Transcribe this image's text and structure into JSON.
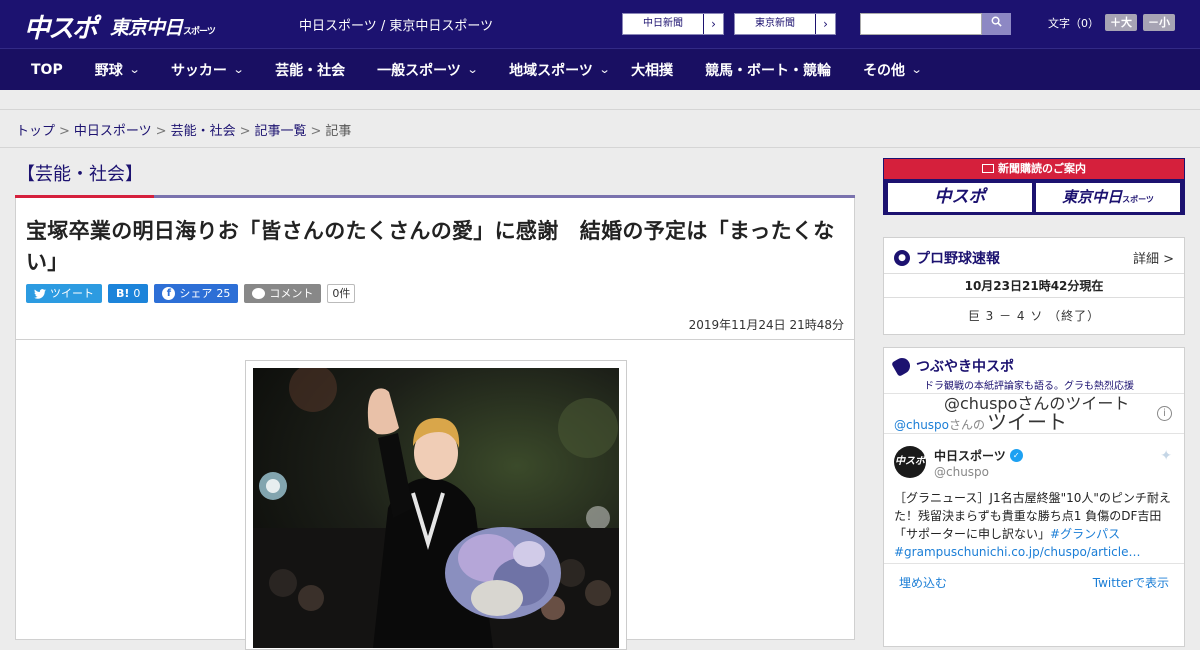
{
  "header": {
    "logo_main": "中スポ",
    "logo_sub": "東京中日",
    "logo_sub_small": "スポーツ",
    "site_name": "中日スポーツ / 東京中日スポーツ",
    "paper_links": [
      {
        "label": "中日新聞"
      },
      {
        "label": "東京新聞"
      }
    ],
    "search_placeholder": "",
    "fontsize_label": "文字（0）",
    "fontsize_up": "＋大",
    "fontsize_down": "－小"
  },
  "nav": {
    "items": [
      {
        "label": "TOP",
        "has_dropdown": false
      },
      {
        "label": "野球",
        "has_dropdown": true
      },
      {
        "label": "サッカー",
        "has_dropdown": true
      },
      {
        "label": "芸能・社会",
        "has_dropdown": false
      },
      {
        "label": "一般スポーツ",
        "has_dropdown": true
      },
      {
        "label": "地域スポーツ",
        "has_dropdown": true
      },
      {
        "label": "大相撲",
        "has_dropdown": false
      },
      {
        "label": "競馬・ボート・競輪",
        "has_dropdown": false
      },
      {
        "label": "その他",
        "has_dropdown": true
      }
    ]
  },
  "breadcrumb": {
    "items": [
      "トップ",
      "中日スポーツ",
      "芸能・社会",
      "記事一覧"
    ],
    "current": "記事",
    "separator": ">"
  },
  "article": {
    "category": "【芸能・社会】",
    "headline": "宝塚卒業の明日海りお「皆さんのたくさんの愛」に感謝　結婚の予定は「まったくない」",
    "share": {
      "tweet_label": "ツイート",
      "hatena_label": "B!",
      "hatena_count": "0",
      "facebook_label": "シェア",
      "facebook_count": "25",
      "comment_label": "コメント",
      "comment_count": "0件"
    },
    "timestamp": "2019年11月24日 21時48分"
  },
  "sidebar": {
    "promo": {
      "title": "新聞購読のご案内",
      "btn_a": "中スポ",
      "btn_b": "東京中日",
      "btn_b_small": "スポーツ"
    },
    "baseball": {
      "title": "プロ野球速報",
      "more": "詳細 >",
      "time": "10月23日21時42分現在",
      "score": "巨 3 － 4 ソ （終了）"
    },
    "tsubuyaki": {
      "title": "つぶやき中スポ",
      "subtitle": "ドラ観戦の本紙評論家も語る。グラも熱烈応援",
      "user_prefix": "@chuspo",
      "user_mid": "さんの",
      "user_big": "ツイート",
      "tweet_name": "中日スポーツ",
      "tweet_handle": "@chuspo",
      "avatar": "中スポ",
      "tweet_text": "［グラニュース］J1名古屋終盤\"10人\"のピンチ耐えた！残留決まらずも貴重な勝ち点1 負傷のDF吉田「サポーターに申し訳ない」",
      "tweet_hash": "#グランパス",
      "tweet_link": "#grampuschunichi.co.jp/chuspo/article…",
      "embed": "埋め込む",
      "view_on": "Twitterで表示",
      "next_title": "@chuspoさんのツイート"
    }
  }
}
